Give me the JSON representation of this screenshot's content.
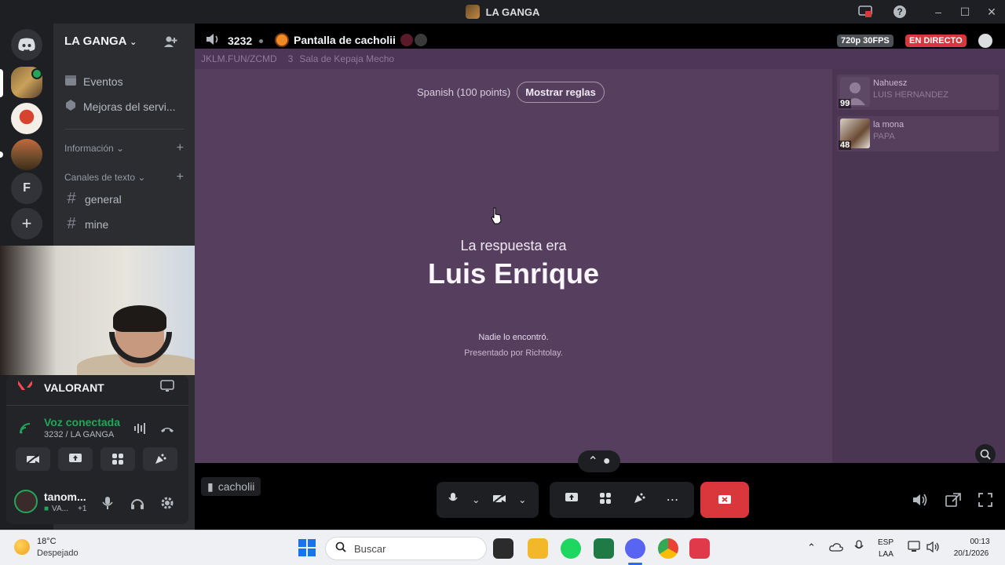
{
  "window": {
    "title": "LA GANGA",
    "controls": [
      "–",
      "☐",
      "✕"
    ]
  },
  "server_rail": {
    "items": [
      {
        "name": "discord-home",
        "label": ""
      },
      {
        "name": "server-1",
        "label": ""
      },
      {
        "name": "server-2",
        "label": ""
      },
      {
        "name": "server-3",
        "label": ""
      },
      {
        "name": "server-f",
        "label": "F"
      },
      {
        "name": "add-server",
        "label": "+"
      }
    ]
  },
  "sidebar": {
    "guild_name": "LA GANGA",
    "items": [
      {
        "label": "Eventos"
      },
      {
        "label": "Mejoras del servi..."
      }
    ],
    "categories": [
      {
        "label": "Información"
      },
      {
        "label": "Canales de texto"
      }
    ],
    "channels": [
      {
        "label": "general"
      },
      {
        "label": "mine"
      }
    ]
  },
  "voice_panel": {
    "activity": "VALORANT",
    "status": "Voz conectada",
    "channel": "3232 / LA GANGA",
    "user": "tanom...",
    "user_sub": "VA...",
    "user_extra": "+1"
  },
  "stream_header": {
    "voice_channel": "3232",
    "stream_title": "Pantalla de cacholii",
    "quality": "720p 30FPS",
    "live_label": "EN DIRECTO"
  },
  "game": {
    "room_url": "JKLM.FUN/ZCMD",
    "room_number": "3",
    "room_name": "Sala de Kepaja Mecho",
    "language": "Spanish (100 points)",
    "rules_button": "Mostrar reglas",
    "answer_caption": "La respuesta era",
    "answer": "Luis Enrique",
    "nobody_found": "Nadie lo encontró.",
    "presented_by": "Presentado por Richtolay.",
    "players": [
      {
        "name": "Nahuesz",
        "word": "LUIS HERNANDEZ",
        "score": "99"
      },
      {
        "name": "la mona",
        "word": "PAPA",
        "score": "48"
      }
    ]
  },
  "stream_footer": {
    "streamer_tag": "cacholii"
  },
  "taskbar": {
    "weather_temp": "18°C",
    "weather_desc": "Despejado",
    "search_placeholder": "Buscar",
    "lang_1": "ESP",
    "lang_2": "LAA",
    "time": "00:13",
    "date": "20/1/2026"
  },
  "colors": {
    "discord_dark": "#1e1f22",
    "sidebar": "#2b2d31",
    "stream_bg": "#553f5c",
    "live_red": "#da373c",
    "connected_green": "#23a55a",
    "end_call": "#da373c"
  }
}
